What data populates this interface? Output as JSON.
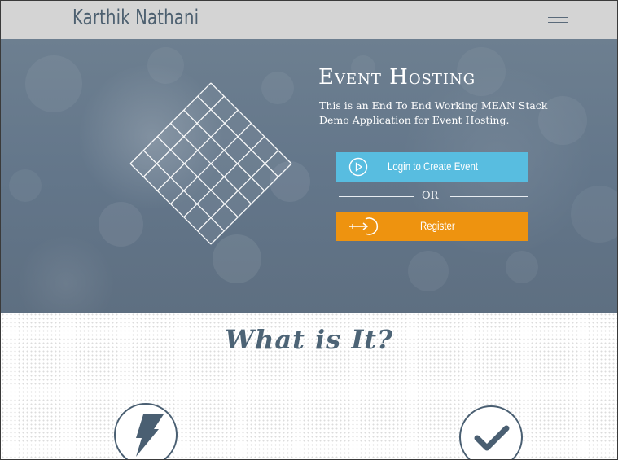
{
  "nav": {
    "brand": "Karthik Nathani",
    "menu_icon": "hamburger-menu-icon"
  },
  "hero": {
    "title": "Event Hosting",
    "description": "This is an End To End Working MEAN Stack Demo Application for Event Hosting.",
    "login_button": {
      "label": "Login to Create Event",
      "icon": "play-circle-icon",
      "color": "#58bde0"
    },
    "separator": "OR",
    "register_button": {
      "label": "Register",
      "icon": "sign-in-icon",
      "color": "#ee930f"
    }
  },
  "about": {
    "title": "What is It?",
    "features": [
      {
        "icon": "lightning-bolt-icon"
      },
      {
        "icon": "checkmark-icon"
      }
    ]
  }
}
